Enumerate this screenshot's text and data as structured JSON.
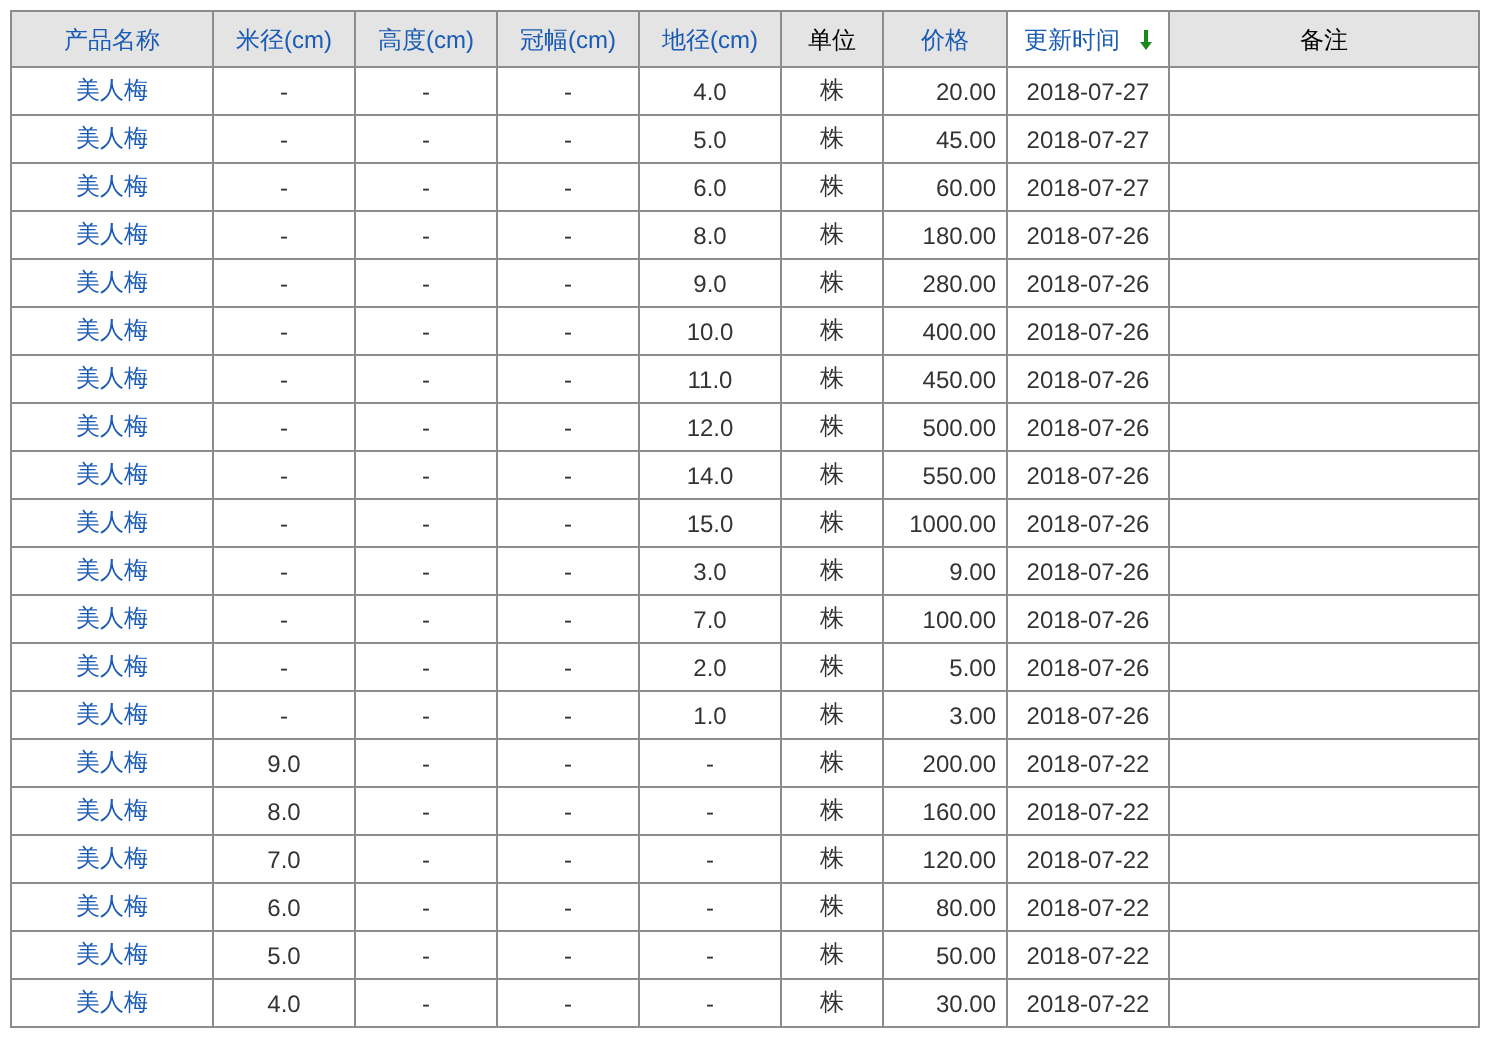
{
  "table": {
    "columns": [
      {
        "label": "产品名称",
        "sortable": true,
        "selected": false
      },
      {
        "label": "米径(cm)",
        "sortable": true,
        "selected": false
      },
      {
        "label": "高度(cm)",
        "sortable": true,
        "selected": false
      },
      {
        "label": "冠幅(cm)",
        "sortable": true,
        "selected": false
      },
      {
        "label": "地径(cm)",
        "sortable": true,
        "selected": false
      },
      {
        "label": "单位",
        "sortable": false,
        "selected": false
      },
      {
        "label": "价格",
        "sortable": true,
        "selected": false
      },
      {
        "label": "更新时间",
        "sortable": true,
        "selected": true
      },
      {
        "label": "备注",
        "sortable": false,
        "selected": false
      }
    ],
    "rows": [
      {
        "name": "美人梅",
        "diameter": "-",
        "height": "-",
        "crown": "-",
        "ground_diameter": "4.0",
        "unit": "株",
        "price": "20.00",
        "updated": "2018-07-27"
      },
      {
        "name": "美人梅",
        "diameter": "-",
        "height": "-",
        "crown": "-",
        "ground_diameter": "5.0",
        "unit": "株",
        "price": "45.00",
        "updated": "2018-07-27"
      },
      {
        "name": "美人梅",
        "diameter": "-",
        "height": "-",
        "crown": "-",
        "ground_diameter": "6.0",
        "unit": "株",
        "price": "60.00",
        "updated": "2018-07-27"
      },
      {
        "name": "美人梅",
        "diameter": "-",
        "height": "-",
        "crown": "-",
        "ground_diameter": "8.0",
        "unit": "株",
        "price": "180.00",
        "updated": "2018-07-26"
      },
      {
        "name": "美人梅",
        "diameter": "-",
        "height": "-",
        "crown": "-",
        "ground_diameter": "9.0",
        "unit": "株",
        "price": "280.00",
        "updated": "2018-07-26"
      },
      {
        "name": "美人梅",
        "diameter": "-",
        "height": "-",
        "crown": "-",
        "ground_diameter": "10.0",
        "unit": "株",
        "price": "400.00",
        "updated": "2018-07-26"
      },
      {
        "name": "美人梅",
        "diameter": "-",
        "height": "-",
        "crown": "-",
        "ground_diameter": "11.0",
        "unit": "株",
        "price": "450.00",
        "updated": "2018-07-26"
      },
      {
        "name": "美人梅",
        "diameter": "-",
        "height": "-",
        "crown": "-",
        "ground_diameter": "12.0",
        "unit": "株",
        "price": "500.00",
        "updated": "2018-07-26"
      },
      {
        "name": "美人梅",
        "diameter": "-",
        "height": "-",
        "crown": "-",
        "ground_diameter": "14.0",
        "unit": "株",
        "price": "550.00",
        "updated": "2018-07-26"
      },
      {
        "name": "美人梅",
        "diameter": "-",
        "height": "-",
        "crown": "-",
        "ground_diameter": "15.0",
        "unit": "株",
        "price": "1000.00",
        "updated": "2018-07-26"
      },
      {
        "name": "美人梅",
        "diameter": "-",
        "height": "-",
        "crown": "-",
        "ground_diameter": "3.0",
        "unit": "株",
        "price": "9.00",
        "updated": "2018-07-26"
      },
      {
        "name": "美人梅",
        "diameter": "-",
        "height": "-",
        "crown": "-",
        "ground_diameter": "7.0",
        "unit": "株",
        "price": "100.00",
        "updated": "2018-07-26"
      },
      {
        "name": "美人梅",
        "diameter": "-",
        "height": "-",
        "crown": "-",
        "ground_diameter": "2.0",
        "unit": "株",
        "price": "5.00",
        "updated": "2018-07-26"
      },
      {
        "name": "美人梅",
        "diameter": "-",
        "height": "-",
        "crown": "-",
        "ground_diameter": "1.0",
        "unit": "株",
        "price": "3.00",
        "updated": "2018-07-26"
      },
      {
        "name": "美人梅",
        "diameter": "9.0",
        "height": "-",
        "crown": "-",
        "ground_diameter": "-",
        "unit": "株",
        "price": "200.00",
        "updated": "2018-07-22"
      },
      {
        "name": "美人梅",
        "diameter": "8.0",
        "height": "-",
        "crown": "-",
        "ground_diameter": "-",
        "unit": "株",
        "price": "160.00",
        "updated": "2018-07-22"
      },
      {
        "name": "美人梅",
        "diameter": "7.0",
        "height": "-",
        "crown": "-",
        "ground_diameter": "-",
        "unit": "株",
        "price": "120.00",
        "updated": "2018-07-22"
      },
      {
        "name": "美人梅",
        "diameter": "6.0",
        "height": "-",
        "crown": "-",
        "ground_diameter": "-",
        "unit": "株",
        "price": "80.00",
        "updated": "2018-07-22"
      },
      {
        "name": "美人梅",
        "diameter": "5.0",
        "height": "-",
        "crown": "-",
        "ground_diameter": "-",
        "unit": "株",
        "price": "50.00",
        "updated": "2018-07-22"
      },
      {
        "name": "美人梅",
        "diameter": "4.0",
        "height": "-",
        "crown": "-",
        "ground_diameter": "-",
        "unit": "株",
        "price": "30.00",
        "updated": "2018-07-22"
      }
    ]
  }
}
